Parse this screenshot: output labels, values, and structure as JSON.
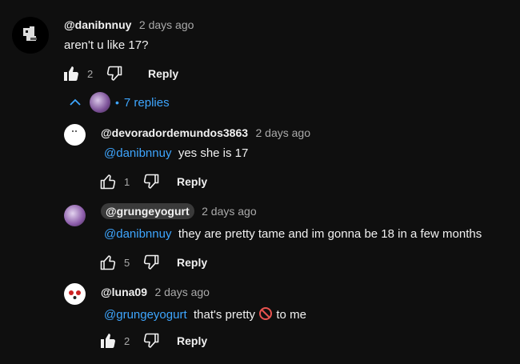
{
  "comment": {
    "handle": "@danibnnuy",
    "time": "2 days ago",
    "text": "aren't u like 17?",
    "likes": "2",
    "reply_label": "Reply",
    "replies_label": "7 replies"
  },
  "replies": [
    {
      "handle": "@devoradordemundos3863",
      "time": "2 days ago",
      "mention": "@danibnnuy",
      "text": "yes she is 17",
      "likes": "1",
      "reply_label": "Reply"
    },
    {
      "handle": "@grungeyogurt",
      "time": "2 days ago",
      "mention": "@danibnnuy",
      "text": "they are pretty tame and im gonna be 18 in a few months",
      "likes": "5",
      "reply_label": "Reply"
    },
    {
      "handle": "@luna09",
      "time": "2 days ago",
      "mention": "@grungeyogurt",
      "text_before": "that's pretty",
      "text_after": "to me",
      "likes": "2",
      "reply_label": "Reply"
    }
  ],
  "colors": {
    "background": "#0f0f0f",
    "text": "#f1f1f1",
    "secondary": "#aaaaaa",
    "link": "#3ea6ff"
  }
}
